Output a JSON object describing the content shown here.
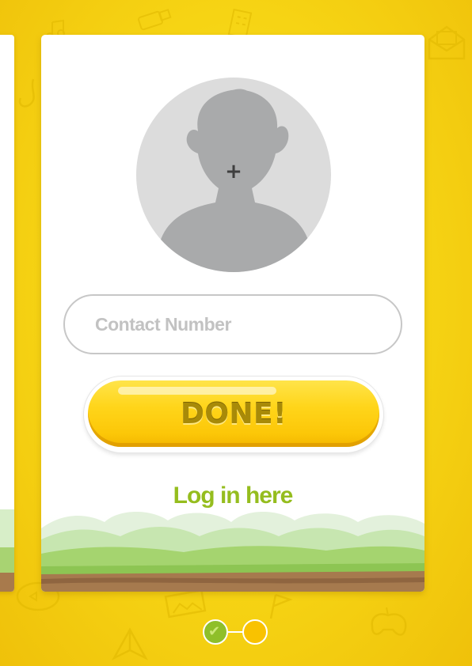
{
  "form": {
    "avatar": {
      "icon": "user-silhouette-icon",
      "add_icon_glyph": "+"
    },
    "contact_number": {
      "placeholder": "Contact Number",
      "value": ""
    },
    "done_button": {
      "label": "DONE!"
    },
    "login_link": {
      "label": "Log in here"
    }
  },
  "pager": {
    "current_step": 2,
    "total_steps": 2,
    "completed_icon_glyph": "✔"
  },
  "colors": {
    "background": "#f6d414",
    "button": "#ffd51a",
    "button_text": "#a88a08",
    "link": "#95bd1e",
    "step_complete": "#8fbf2a",
    "step_current": "#f9c200"
  }
}
